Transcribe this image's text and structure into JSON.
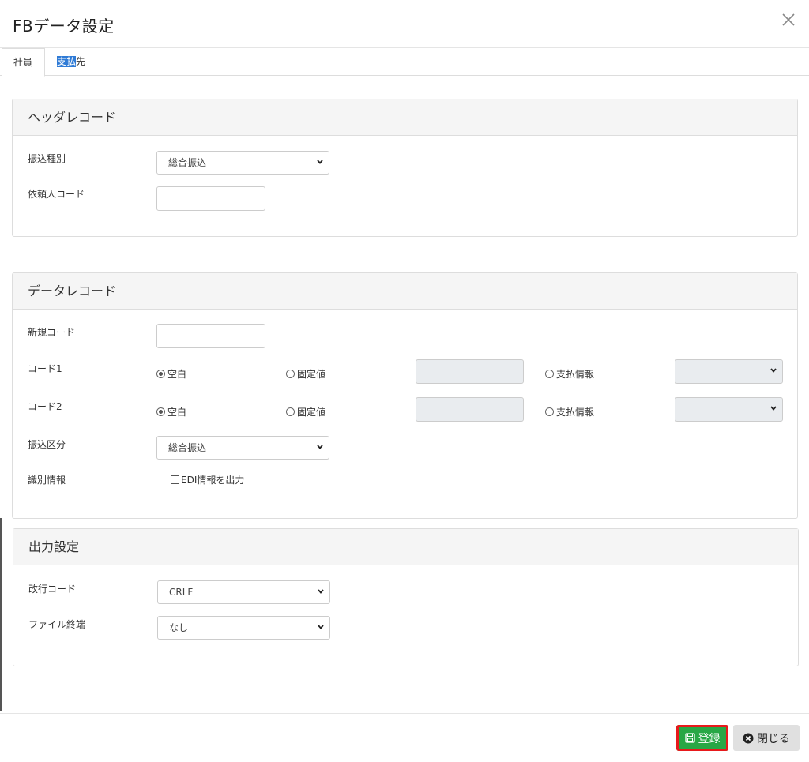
{
  "dialog": {
    "title": "FBデータ設定"
  },
  "tabs": {
    "employee": "社員",
    "payee_highlight": "支払",
    "payee_rest": "先"
  },
  "header_record": {
    "title": "ヘッダレコード",
    "transfer_type_label": "振込種別",
    "transfer_type_value": "総合振込",
    "requester_code_label": "依頼人コード",
    "requester_code_value": ""
  },
  "data_record": {
    "title": "データレコード",
    "new_code_label": "新規コード",
    "new_code_value": "",
    "code1_label": "コード1",
    "code2_label": "コード2",
    "opt_blank": "空白",
    "opt_fixed": "固定値",
    "opt_payment_info": "支払情報",
    "transfer_class_label": "振込区分",
    "transfer_class_value": "総合振込",
    "identification_label": "識別情報",
    "edi_checkbox_label": "EDI情報を出力"
  },
  "output_settings": {
    "title": "出力設定",
    "newline_label": "改行コード",
    "newline_value": "CRLF",
    "file_end_label": "ファイル終端",
    "file_end_value": "なし"
  },
  "footer": {
    "save_label": "登録",
    "close_label": "閉じる"
  },
  "colors": {
    "save": "#28a745",
    "highlight": "#2f7bd6",
    "focus_outline": "#e8191c"
  }
}
